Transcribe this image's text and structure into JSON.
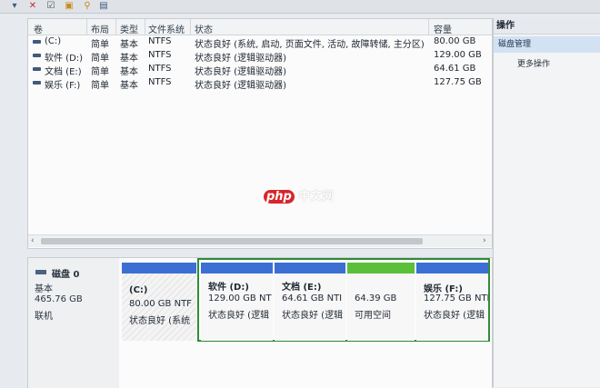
{
  "colors": {
    "primary_blue": "#3b6fd4",
    "free_green": "#5bbf3a",
    "ext_frame": "#2f8b36",
    "section_bg": "#d2e2f3"
  },
  "toolbar": {
    "icons": [
      "comment-icon",
      "delete-icon",
      "check-icon",
      "folder-icon",
      "search-icon",
      "view-icon"
    ],
    "glyphs": [
      "▾",
      "✕",
      "☑",
      "▣",
      "⚲",
      "▤"
    ]
  },
  "table": {
    "headers": {
      "volume": "卷",
      "layout": "布局",
      "type": "类型",
      "fs": "文件系统",
      "status": "状态",
      "capacity": "容量"
    },
    "rows": [
      {
        "volume": "(C:)",
        "layout": "简单",
        "type": "基本",
        "fs": "NTFS",
        "status": "状态良好 (系统, 启动, 页面文件, 活动, 故障转储, 主分区)",
        "capacity": "80.00 GB"
      },
      {
        "volume": "软件 (D:)",
        "layout": "简单",
        "type": "基本",
        "fs": "NTFS",
        "status": "状态良好 (逻辑驱动器)",
        "capacity": "129.00 GB"
      },
      {
        "volume": "文档 (E:)",
        "layout": "简单",
        "type": "基本",
        "fs": "NTFS",
        "status": "状态良好 (逻辑驱动器)",
        "capacity": "64.61 GB"
      },
      {
        "volume": "娱乐 (F:)",
        "layout": "简单",
        "type": "基本",
        "fs": "NTFS",
        "status": "状态良好 (逻辑驱动器)",
        "capacity": "127.75 GB"
      }
    ]
  },
  "scroll": {
    "left": "‹",
    "right": "›"
  },
  "actions": {
    "title": "操作",
    "section": "磁盘管理",
    "more": "更多操作"
  },
  "disk": {
    "name": "磁盘 0",
    "type": "基本",
    "size": "465.76 GB",
    "state": "联机"
  },
  "partitions": [
    {
      "name": "(C:)",
      "size": "80.00 GB NTF",
      "status": "状态良好 (系统"
    },
    {
      "name": "软件 (D:)",
      "size": "129.00 GB NT",
      "status": "状态良好 (逻辑"
    },
    {
      "name": "文档 (E:)",
      "size": "64.61 GB NTI",
      "status": "状态良好 (逻辑"
    },
    {
      "name": "",
      "size": "64.39 GB",
      "status": "可用空间"
    },
    {
      "name": "娱乐 (F:)",
      "size": "127.75 GB NTI",
      "status": "状态良好 (逻辑"
    }
  ],
  "watermark": {
    "php": "php",
    "cn": "中文网"
  }
}
